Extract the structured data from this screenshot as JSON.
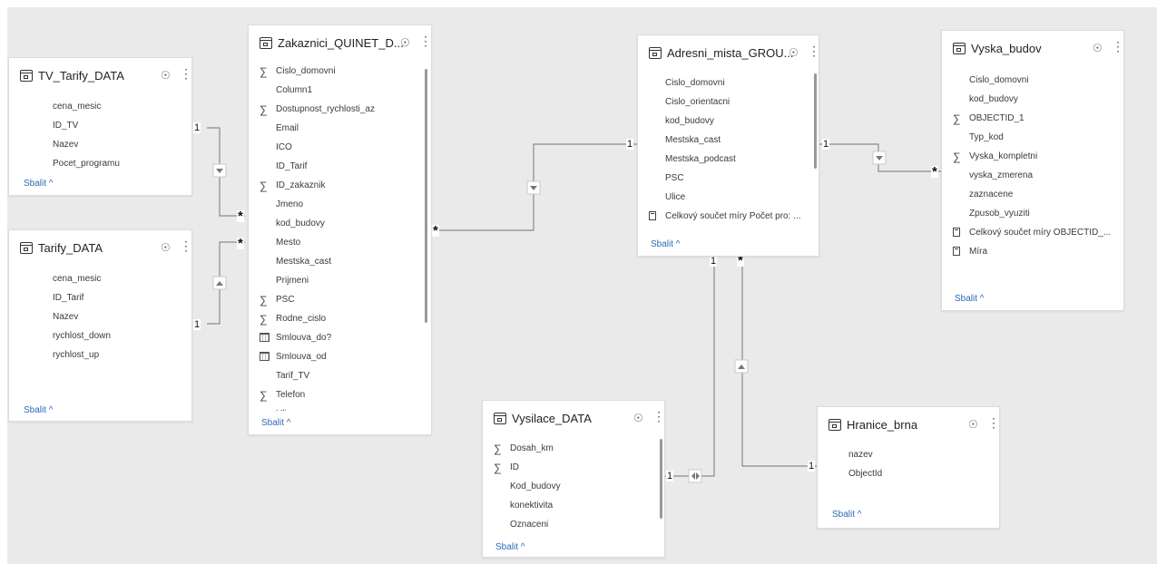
{
  "tables": {
    "tv_tarify": {
      "title": "TV_Tarify_DATA",
      "fields": [
        {
          "icon": "none",
          "label": "cena_mesic"
        },
        {
          "icon": "none",
          "label": "ID_TV"
        },
        {
          "icon": "none",
          "label": "Nazev"
        },
        {
          "icon": "none",
          "label": "Pocet_programu"
        }
      ],
      "collapse": "Sbalit ^"
    },
    "tarify": {
      "title": "Tarify_DATA",
      "fields": [
        {
          "icon": "none",
          "label": "cena_mesic"
        },
        {
          "icon": "none",
          "label": "ID_Tarif"
        },
        {
          "icon": "none",
          "label": "Nazev"
        },
        {
          "icon": "none",
          "label": "rychlost_down"
        },
        {
          "icon": "none",
          "label": "rychlost_up"
        }
      ],
      "collapse": "Sbalit ^"
    },
    "zakaznici": {
      "title": "Zakaznici_QUINET_D...",
      "fields": [
        {
          "icon": "sigma",
          "label": "Cislo_domovni"
        },
        {
          "icon": "none",
          "label": "Column1"
        },
        {
          "icon": "sigma",
          "label": "Dostupnost_rychlosti_az"
        },
        {
          "icon": "none",
          "label": "Email"
        },
        {
          "icon": "none",
          "label": "ICO"
        },
        {
          "icon": "none",
          "label": "ID_Tarif"
        },
        {
          "icon": "sigma",
          "label": "ID_zakaznik"
        },
        {
          "icon": "none",
          "label": "Jmeno"
        },
        {
          "icon": "none",
          "label": "kod_budovy"
        },
        {
          "icon": "none",
          "label": "Mesto"
        },
        {
          "icon": "none",
          "label": "Mestska_cast"
        },
        {
          "icon": "none",
          "label": "Prijmeni"
        },
        {
          "icon": "sigma",
          "label": "PSC"
        },
        {
          "icon": "sigma",
          "label": "Rodne_cislo"
        },
        {
          "icon": "calendar",
          "label": "Smlouva_do?"
        },
        {
          "icon": "calendar",
          "label": "Smlouva_od"
        },
        {
          "icon": "none",
          "label": "Tarif_TV"
        },
        {
          "icon": "sigma",
          "label": "Telefon"
        },
        {
          "icon": "none",
          "label": "Ulice"
        }
      ],
      "collapse": "Sbalit ^"
    },
    "adresni": {
      "title": "Adresni_mista_GROU...",
      "fields": [
        {
          "icon": "none",
          "label": "Cislo_domovni"
        },
        {
          "icon": "none",
          "label": "Cislo_orientacni"
        },
        {
          "icon": "none",
          "label": "kod_budovy"
        },
        {
          "icon": "none",
          "label": "Mestska_cast"
        },
        {
          "icon": "none",
          "label": "Mestska_podcast"
        },
        {
          "icon": "none",
          "label": "PSC"
        },
        {
          "icon": "none",
          "label": "Ulice"
        },
        {
          "icon": "calc",
          "label": "Celkový součet míry Počet pro: ..."
        },
        {
          "icon": "calc",
          "label": ""
        }
      ],
      "collapse": "Sbalit ^"
    },
    "vyska": {
      "title": "Vyska_budov",
      "fields": [
        {
          "icon": "none",
          "label": "Cislo_domovni"
        },
        {
          "icon": "none",
          "label": "kod_budovy"
        },
        {
          "icon": "sigma",
          "label": "OBJECTID_1"
        },
        {
          "icon": "none",
          "label": "Typ_kod"
        },
        {
          "icon": "sigma",
          "label": "Vyska_kompletni"
        },
        {
          "icon": "none",
          "label": "vyska_zmerena"
        },
        {
          "icon": "none",
          "label": "zaznacene"
        },
        {
          "icon": "none",
          "label": "Zpusob_vyuziti"
        },
        {
          "icon": "calc",
          "label": "Celkový součet míry OBJECTID_..."
        },
        {
          "icon": "calc",
          "label": "Míra"
        }
      ],
      "collapse": "Sbalit ^"
    },
    "vysilace": {
      "title": "Vysilace_DATA",
      "fields": [
        {
          "icon": "sigma",
          "label": "Dosah_km"
        },
        {
          "icon": "sigma",
          "label": "ID"
        },
        {
          "icon": "none",
          "label": "Kod_budovy"
        },
        {
          "icon": "none",
          "label": "konektivita"
        },
        {
          "icon": "none",
          "label": "Oznaceni"
        }
      ],
      "collapse": "Sbalit ^"
    },
    "hranice": {
      "title": "Hranice_brna",
      "fields": [
        {
          "icon": "none",
          "label": "nazev"
        },
        {
          "icon": "none",
          "label": "ObjectId"
        }
      ],
      "collapse": "Sbalit ^"
    }
  },
  "cardinality": {
    "one": "1",
    "many": "*"
  },
  "icons": {
    "eye": "eye-icon",
    "more": "more-options-icon",
    "table": "table-icon",
    "sigma": "sigma-icon",
    "calendar": "calendar-icon",
    "calc": "measure-icon"
  }
}
